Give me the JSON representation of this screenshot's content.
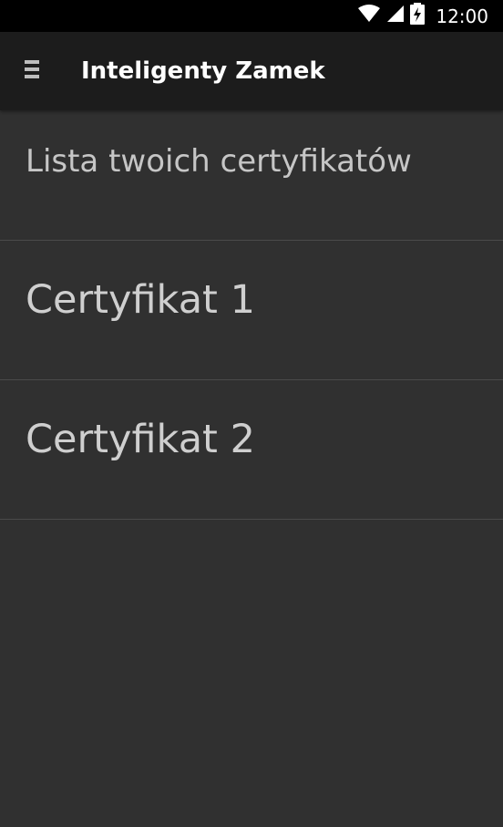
{
  "status_bar": {
    "time": "12:00",
    "icons": [
      "wifi-icon",
      "signal-icon",
      "battery-charging-icon"
    ]
  },
  "app_bar": {
    "menu_icon": "hamburger-menu-icon",
    "title": "Inteligenty Zamek"
  },
  "main": {
    "header": "Lista twoich certyfikatów",
    "certificates": [
      {
        "label": "Certyfikat 1"
      },
      {
        "label": "Certyfikat 2"
      }
    ]
  },
  "colors": {
    "background": "#303030",
    "app_bar": "#1c1c1c",
    "status_bar": "#000000",
    "divider": "#4a4a4a",
    "text_primary": "#ffffff",
    "text_secondary": "#c6c6c6"
  }
}
